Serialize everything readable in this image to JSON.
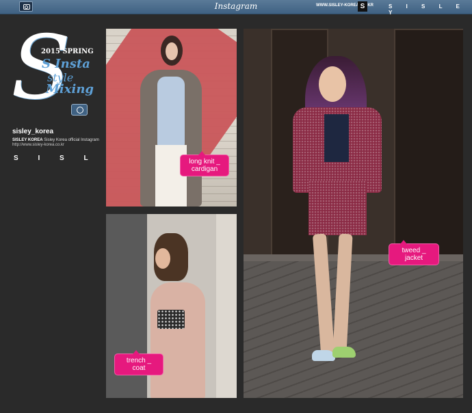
{
  "topbar": {
    "title": "Instagram",
    "url": "WWW.SISLEY-KOREA.CO.KR",
    "badge": "S",
    "brand": "S I S L E Y"
  },
  "logo": {
    "big_letter": "S",
    "season": "2015 SPRING",
    "line1": "S Insta",
    "line2": "style",
    "line3": "Mixing"
  },
  "profile": {
    "username": "sisley_korea",
    "bio_name": "SISLEY KOREA",
    "bio_text": "Sisley Korea official Instagram",
    "link": "http://www.sisley-korea.co.kr",
    "brand": "S I S L E Y"
  },
  "tags": {
    "cardigan": "long knit _\ncardigan",
    "trench": "trench _\ncoat",
    "tweed": "tweed _\njacket"
  },
  "colors": {
    "topbar": "#4a6d8e",
    "background": "#2a2a2a",
    "tag": "#e6197e",
    "logo_accent": "#5ea0d6"
  }
}
